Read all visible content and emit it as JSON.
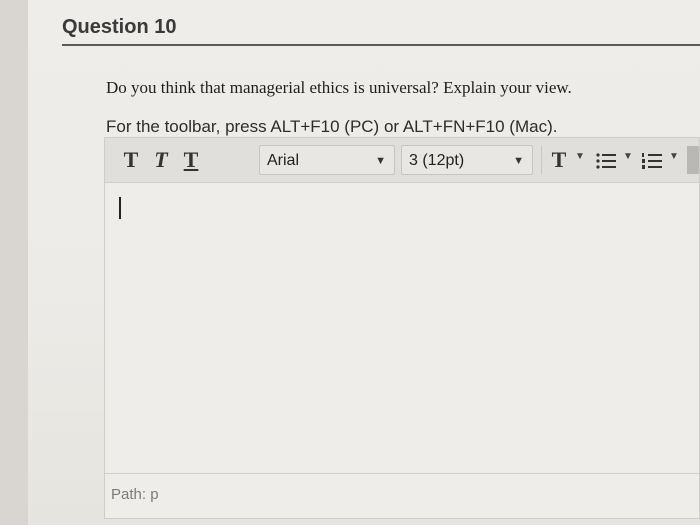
{
  "question": {
    "title": "Question 10",
    "text": "Do you think that managerial ethics is universal? Explain your view."
  },
  "hint": "For the toolbar, press ALT+F10 (PC) or ALT+FN+F10 (Mac).",
  "toolbar": {
    "format_buttons": [
      {
        "label": "T",
        "icon": "bold-icon"
      },
      {
        "label": "T",
        "icon": "italic-icon"
      },
      {
        "label": "T",
        "icon": "underline-icon"
      }
    ],
    "font_family": "Arial",
    "font_size": "3 (12pt)",
    "text_color_label": "T"
  },
  "editor": {
    "body_value": ""
  },
  "status": {
    "path": "Path: p"
  }
}
